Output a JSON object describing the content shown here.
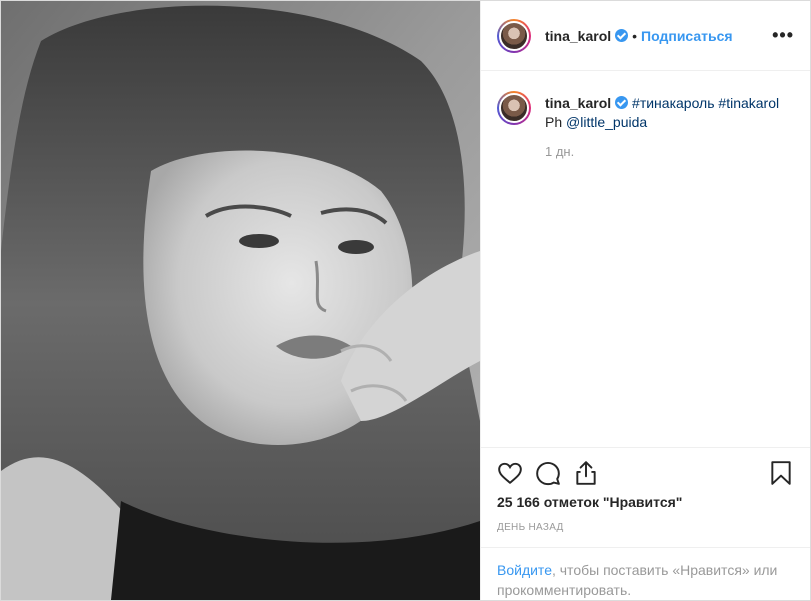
{
  "post": {
    "image_alt": "Black and white portrait photo",
    "header": {
      "username": "tina_karol",
      "separator": "•",
      "follow_label": "Подписаться",
      "more_label": "•••"
    },
    "caption": {
      "username": "tina_karol",
      "hashtag_1": "#тинакароль",
      "hashtag_2": "#tinakarol",
      "credit_prefix": "Ph",
      "mention": "@little_puida",
      "time": "1 дн."
    },
    "actions": {
      "like_icon": "heart-icon",
      "comment_icon": "comment-icon",
      "share_icon": "share-icon",
      "save_icon": "bookmark-icon"
    },
    "likes_text": "25 166 отметок \"Нравится\"",
    "posted_ago": "ДЕНЬ НАЗАД",
    "login_prompt": {
      "link": "Войдите",
      "rest": ", чтобы поставить «Нравится» или прокомментировать."
    }
  },
  "colors": {
    "accent": "#3897f0",
    "hashtag": "#003569",
    "muted": "#999999",
    "text": "#262626"
  }
}
